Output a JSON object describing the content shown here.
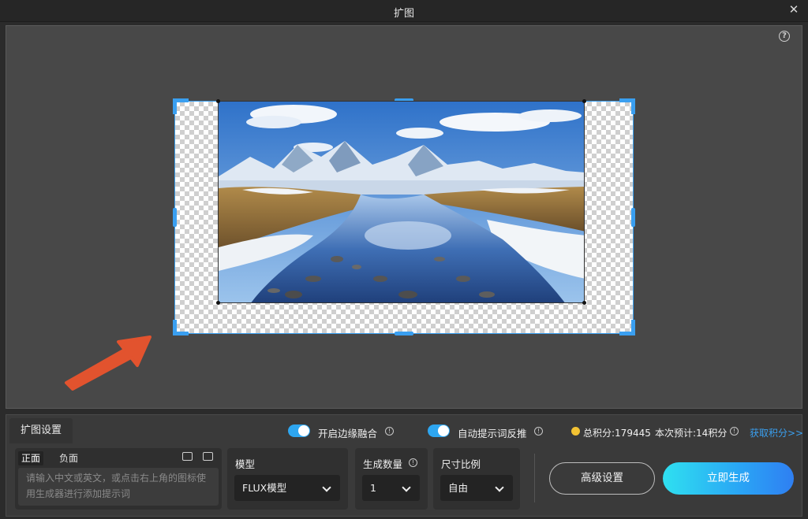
{
  "window": {
    "title": "扩图",
    "close_icon": "close-icon"
  },
  "canvas": {
    "help_icon": "question-circle-icon",
    "help_glyph": "?"
  },
  "panel": {
    "tab_label": "扩图设置",
    "edge_blend": {
      "label": "开启边缘融合",
      "on": true
    },
    "auto_prompt": {
      "label": "自动提示词反推",
      "on": true
    },
    "points": {
      "total": "总积分:179445",
      "estimate": "本次预计:14积分"
    },
    "get_points_link": "获取积分>>",
    "prompt": {
      "tab_positive": "正面",
      "tab_negative": "负面",
      "placeholder": "请输入中文或英文，或点击右上角的图标使用生成器进行添加提示词"
    },
    "model": {
      "label": "模型",
      "value": "FLUX模型"
    },
    "count": {
      "label": "生成数量",
      "value": "1"
    },
    "ratio": {
      "label": "尺寸比例",
      "value": "自由"
    },
    "advanced_button": "高级设置",
    "generate_button": "立即生成"
  },
  "colors": {
    "accent": "#3a9ff0",
    "arrow": "#e2532e",
    "coin": "#f2c233"
  }
}
